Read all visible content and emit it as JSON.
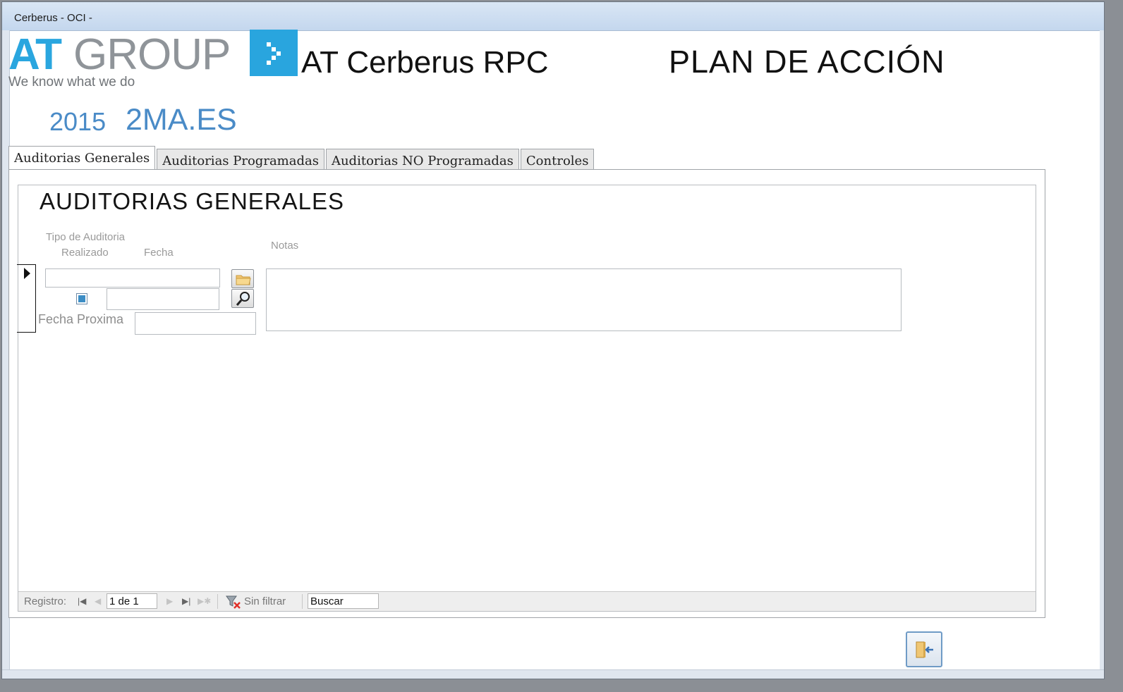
{
  "window": {
    "title": "Cerberus - OCI -"
  },
  "header": {
    "logo_at": "AT",
    "logo_group": "GROUP",
    "logo_tagline": "We know what we do",
    "logo_icon": "chevron-dots-icon",
    "app_title": "AT Cerberus RPC",
    "page_title": "PLAN DE ACCIÓN",
    "year": "2015",
    "code": "2MA.ES"
  },
  "tabs": [
    {
      "label": "Auditorias Generales",
      "active": true
    },
    {
      "label": "Auditorias Programadas",
      "active": false
    },
    {
      "label": "Auditorias NO Programadas",
      "active": false
    },
    {
      "label": "Controles",
      "active": false
    }
  ],
  "form": {
    "section_title": "AUDITORIAS GENERALES",
    "labels": {
      "tipo": "Tipo de Auditoria",
      "realizado": "Realizado",
      "fecha": "Fecha",
      "notas": "Notas",
      "fecha_proxima": "Fecha Proxima"
    },
    "values": {
      "tipo": "",
      "realizado": true,
      "fecha": "",
      "fecha_proxima": "",
      "notas": ""
    },
    "icons": {
      "open": "folder-icon",
      "search": "magnifier-icon"
    }
  },
  "navigation": {
    "label": "Registro:",
    "record": "1 de 1",
    "filter": "Sin filtrar",
    "search": "Buscar"
  },
  "exit_button": {
    "icon": "exit-door-icon"
  },
  "colors": {
    "brand_blue": "#29a5de",
    "year_blue": "#4a8bc7",
    "logo_gray": "#8f9499"
  }
}
